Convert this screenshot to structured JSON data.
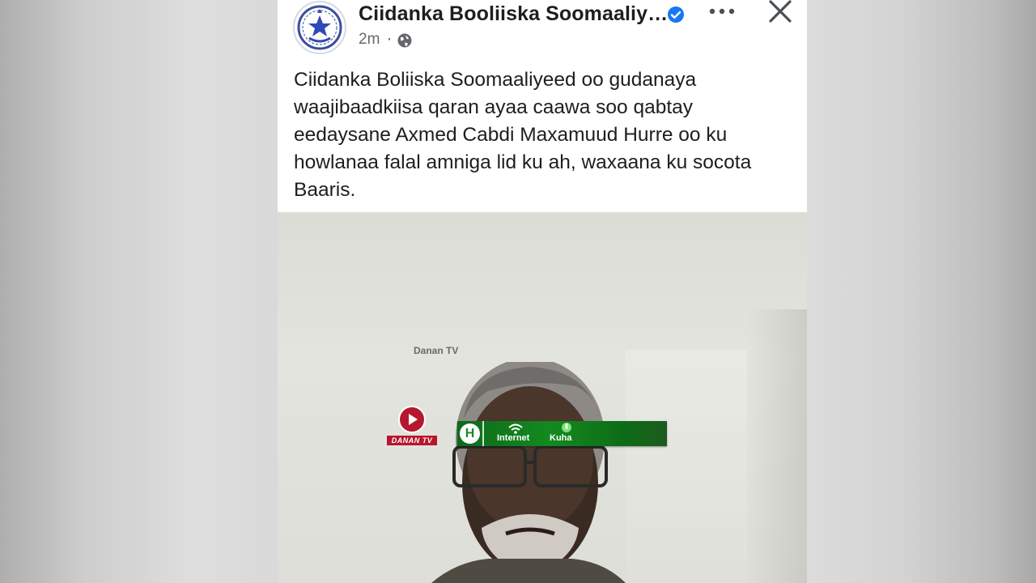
{
  "post": {
    "page_name": "Ciidanka Booliiska Soomaaliy…",
    "time": "2m",
    "separator": "·",
    "text_lines": [
      "Ciidanka Boliiska Soomaaliyeed oo gudanaya",
      "waajibaadkiisa qaran ayaa caawa soo qabtay",
      "eedaysane Axmed Cabdi Maxamuud Hurre oo ku",
      "howlanaa falal amniga lid ku ah, waxaana ku socota",
      "Baaris."
    ],
    "icons": {
      "avatar": "police-emblem-icon",
      "verified": "verified-badge-icon",
      "audience": "globe-icon",
      "more": "more-options-icon",
      "close": "close-icon"
    }
  },
  "photo": {
    "watermark": "Danan TV",
    "logo_text": "DANAN TV",
    "ticker": {
      "badge": "H",
      "items": [
        "Internet",
        "Kuha"
      ]
    }
  },
  "colors": {
    "verified_blue": "#1877f2",
    "text_primary": "#1c1e21",
    "text_secondary": "#65676b",
    "danan_red": "#b7172d",
    "ticker_green": "#14891f"
  }
}
